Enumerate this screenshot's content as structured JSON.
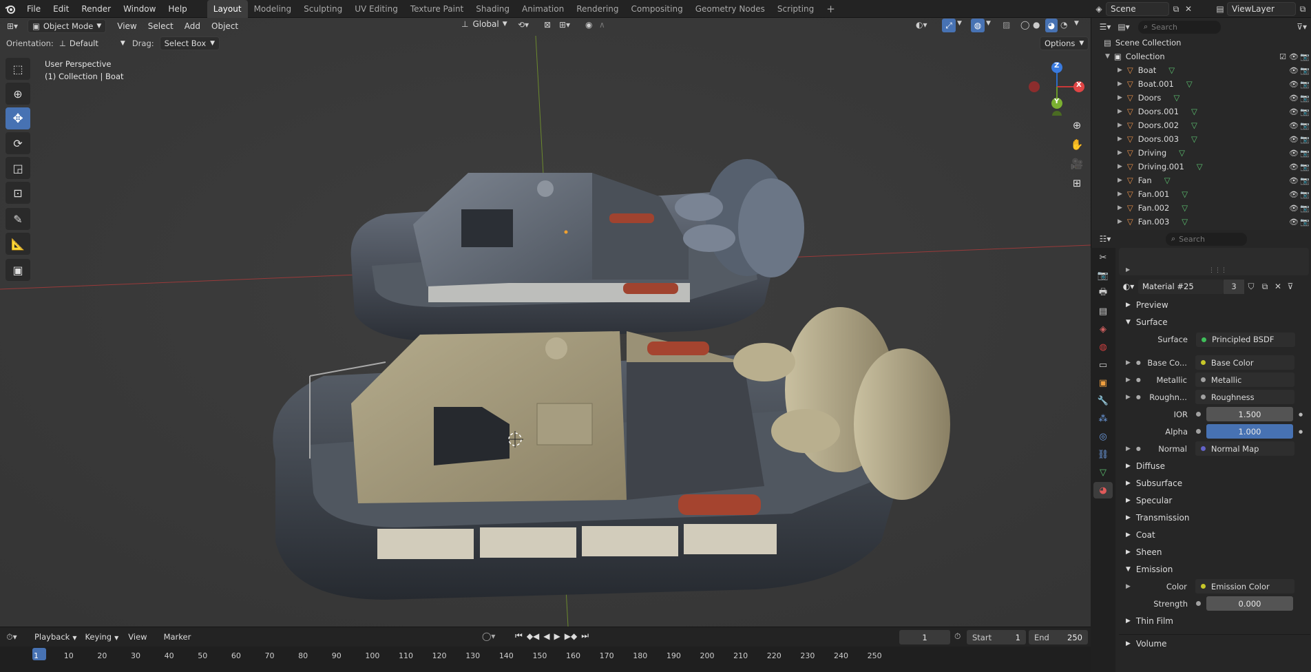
{
  "menu": {
    "items": [
      "File",
      "Edit",
      "Render",
      "Window",
      "Help"
    ]
  },
  "workspaces": {
    "tabs": [
      "Layout",
      "Modeling",
      "Sculpting",
      "UV Editing",
      "Texture Paint",
      "Shading",
      "Animation",
      "Rendering",
      "Compositing",
      "Geometry Nodes",
      "Scripting"
    ],
    "active": "Layout",
    "add": "+"
  },
  "scene": {
    "name": "Scene",
    "view_layer": "ViewLayer"
  },
  "viewport": {
    "mode": "Object Mode",
    "menus": [
      "View",
      "Select",
      "Add",
      "Object"
    ],
    "transform": "Global",
    "orientation_label": "Orientation:",
    "orientation_value": "Default",
    "drag_label": "Drag:",
    "drag_value": "Select Box",
    "options": "Options",
    "overlay_title": "User Perspective",
    "overlay_subtitle": "(1) Collection | Boat",
    "gizmo": {
      "x": "X",
      "y": "Y",
      "z": "Z"
    }
  },
  "timeline": {
    "menus": [
      "Playback",
      "Keying",
      "View",
      "Marker"
    ],
    "current_frame": "1",
    "start_label": "Start",
    "start": "1",
    "end_label": "End",
    "end": "250",
    "ticks": [
      "1",
      "10",
      "20",
      "30",
      "40",
      "50",
      "60",
      "70",
      "80",
      "90",
      "100",
      "110",
      "120",
      "130",
      "140",
      "150",
      "160",
      "170",
      "180",
      "190",
      "200",
      "210",
      "220",
      "230",
      "240",
      "250"
    ]
  },
  "outliner": {
    "search_placeholder": "Search",
    "root": "Scene Collection",
    "collection": "Collection",
    "items": [
      "Boat",
      "Boat.001",
      "Doors",
      "Doors.001",
      "Doors.002",
      "Doors.003",
      "Driving",
      "Driving.001",
      "Fan",
      "Fan.001",
      "Fan.002",
      "Fan.003"
    ]
  },
  "properties": {
    "search_placeholder": "Search",
    "material_name": "Material #25",
    "material_users": "3",
    "sections": {
      "preview": "Preview",
      "surface": "Surface"
    },
    "surface_label": "Surface",
    "surface_value": "Principled BSDF",
    "inputs": [
      {
        "label": "Base Co...",
        "value": "Base Color",
        "dot": "#c7c729",
        "kind": "slot"
      },
      {
        "label": "Metallic",
        "value": "Metallic",
        "dot": "#a1a1a1",
        "kind": "slot"
      },
      {
        "label": "Roughn...",
        "value": "Roughness",
        "dot": "#a1a1a1",
        "kind": "slot"
      },
      {
        "label": "IOR",
        "value": "1.500",
        "dot": "#a1a1a1",
        "kind": "num"
      },
      {
        "label": "Alpha",
        "value": "1.000",
        "dot": "#a1a1a1",
        "kind": "num-active"
      },
      {
        "label": "Normal",
        "value": "Normal Map",
        "dot": "#6363c7",
        "kind": "slot"
      }
    ],
    "subsections": [
      "Diffuse",
      "Subsurface",
      "Specular",
      "Transmission",
      "Coat",
      "Sheen"
    ],
    "emission": {
      "title": "Emission",
      "color_label": "Color",
      "color_value": "Emission Color",
      "strength_label": "Strength",
      "strength_value": "0.000"
    },
    "thin_film": "Thin Film",
    "volume": "Volume"
  },
  "colors": {
    "accent": "#4772b3",
    "active_tab": "#3d3d3d"
  }
}
